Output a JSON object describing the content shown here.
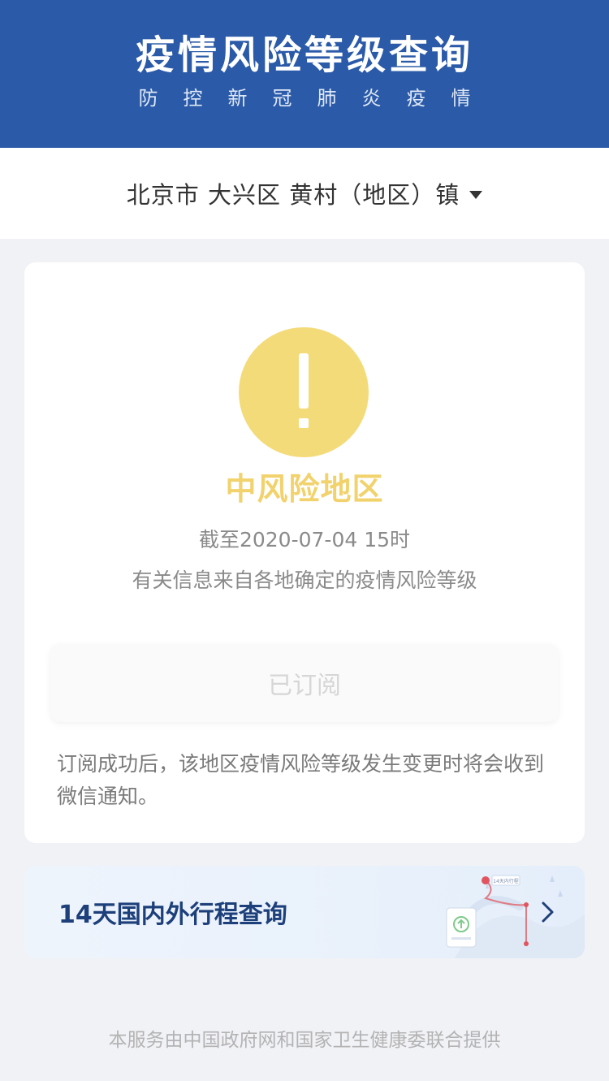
{
  "header": {
    "title": "疫情风险等级查询",
    "subtitle": "防控新冠肺炎疫情"
  },
  "region": {
    "selected": "北京市 大兴区 黄村（地区）镇"
  },
  "status": {
    "risk_level": "中风险地区",
    "as_of": "截至2020-07-04 15时",
    "source_note": "有关信息来自各地确定的疫情风险等级",
    "subscribe_label": "已订阅",
    "subscribe_note": "订阅成功后，该地区疫情风险等级发生变更时将会收到微信通知。",
    "risk_color": "#f4db7a"
  },
  "trip": {
    "label": "14天国内外行程查询",
    "badge": "14天内行程"
  },
  "footer": {
    "note": "本服务由中国政府网和国家卫生健康委联合提供"
  },
  "colors": {
    "header_bg": "#2a5aa8",
    "page_bg": "#f1f2f6",
    "risk_text": "#f2d26c"
  }
}
